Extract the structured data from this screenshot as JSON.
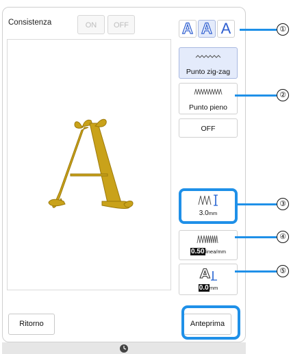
{
  "consistenza": {
    "label": "Consistenza",
    "on_label": "ON",
    "off_label": "OFF"
  },
  "font_buttons": [
    {
      "glyph": "A",
      "style": "outline"
    },
    {
      "glyph": "A",
      "style": "outline-selected"
    },
    {
      "glyph": "A",
      "style": "normal"
    }
  ],
  "stitches": {
    "zigzag_label": "Punto zig-zag",
    "zigzag_icon": "zigzag-stitch-icon",
    "satin_label": "Punto pieno",
    "satin_icon": "satin-stitch-icon",
    "off_label": "OFF"
  },
  "settings": {
    "width": {
      "value": "3.0",
      "unit": "mm",
      "icon": "zigzag-width-icon"
    },
    "density": {
      "value": "0.50",
      "unit": "linea/mm",
      "icon": "density-icon"
    },
    "offset": {
      "value": "0.0",
      "unit": "mm",
      "icon": "pull-compensation-icon"
    }
  },
  "preview": {
    "letter": "A",
    "thread_color": "#c9a21a"
  },
  "buttons": {
    "back": "Ritorno",
    "preview": "Anteprima"
  },
  "callouts": [
    "①",
    "②",
    "③",
    "④",
    "⑤"
  ],
  "colors": {
    "accent": "#1f90e8",
    "selected_bg": "#e4ebfb",
    "font_blue": "#2f5fd0"
  }
}
